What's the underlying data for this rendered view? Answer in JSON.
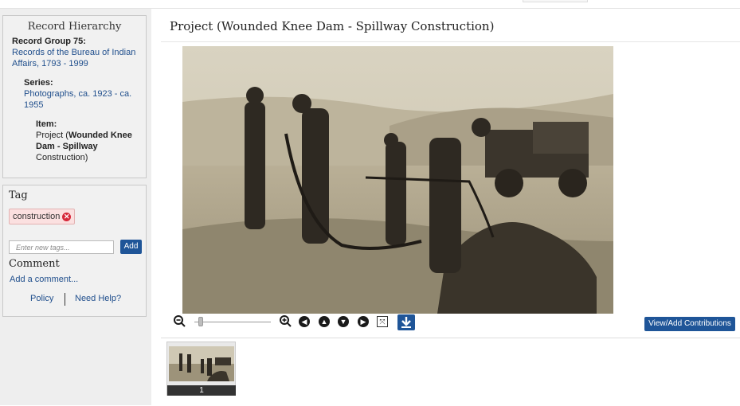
{
  "sidebar": {
    "hierarchy_title": "Record Hierarchy",
    "record_group_label": "Record Group 75:",
    "record_group_link": "Records of the Bureau of Indian Affairs, 1793 - 1999",
    "series_label": "Series:",
    "series_link": "Photographs, ca. 1923 - ca. 1955",
    "item_label": "Item:",
    "item_prefix": "Project (",
    "item_bold": "Wounded Knee Dam - Spillway",
    "item_suffix": "Construction)"
  },
  "tag": {
    "title": "Tag",
    "chips": [
      "construction"
    ],
    "input_placeholder": "Enter new tags...",
    "add_label": "Add"
  },
  "comment": {
    "title": "Comment",
    "add_link": "Add a comment...",
    "policy": "Policy",
    "help": "Need Help?"
  },
  "main": {
    "title": "Project (Wounded Knee Dam - Spillway Construction)",
    "contrib_label": "View/Add Contributions",
    "zoom_level": 0.05
  },
  "thumbnails": [
    {
      "number": "1"
    }
  ],
  "colors": {
    "accent": "#1f5598",
    "chip_bg": "#fbe0e0",
    "chip_remove": "#d6283a",
    "link": "#1f4e8c"
  },
  "icons": [
    "zoom-out-icon",
    "zoom-in-icon",
    "rotate-left-icon",
    "arrow-up-icon",
    "arrow-down-icon",
    "rotate-right-icon",
    "fit-screen-icon",
    "download-icon",
    "remove-tag-icon"
  ]
}
